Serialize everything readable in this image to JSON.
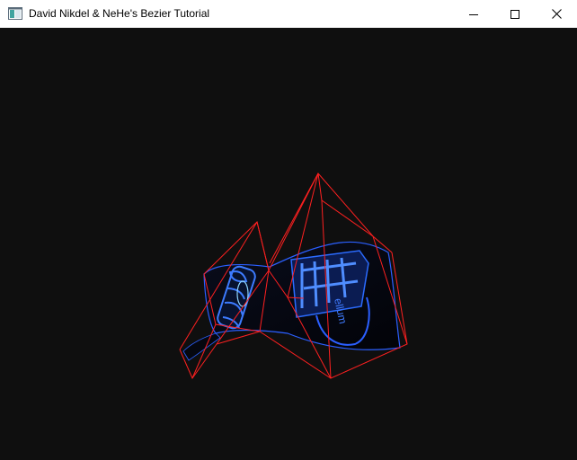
{
  "window": {
    "title": "David Nikdel & NeHe's Bezier Tutorial",
    "icon": "application-window-icon"
  },
  "controls": {
    "minimize_icon": "minimize-icon",
    "maximize_icon": "maximize-icon",
    "close_icon": "close-icon"
  },
  "scene": {
    "background_color": "#0f0f0f",
    "control_grid_color": "#ff2020",
    "texture_color": "#1f5cff",
    "texture_text": "NeHe Productions"
  }
}
